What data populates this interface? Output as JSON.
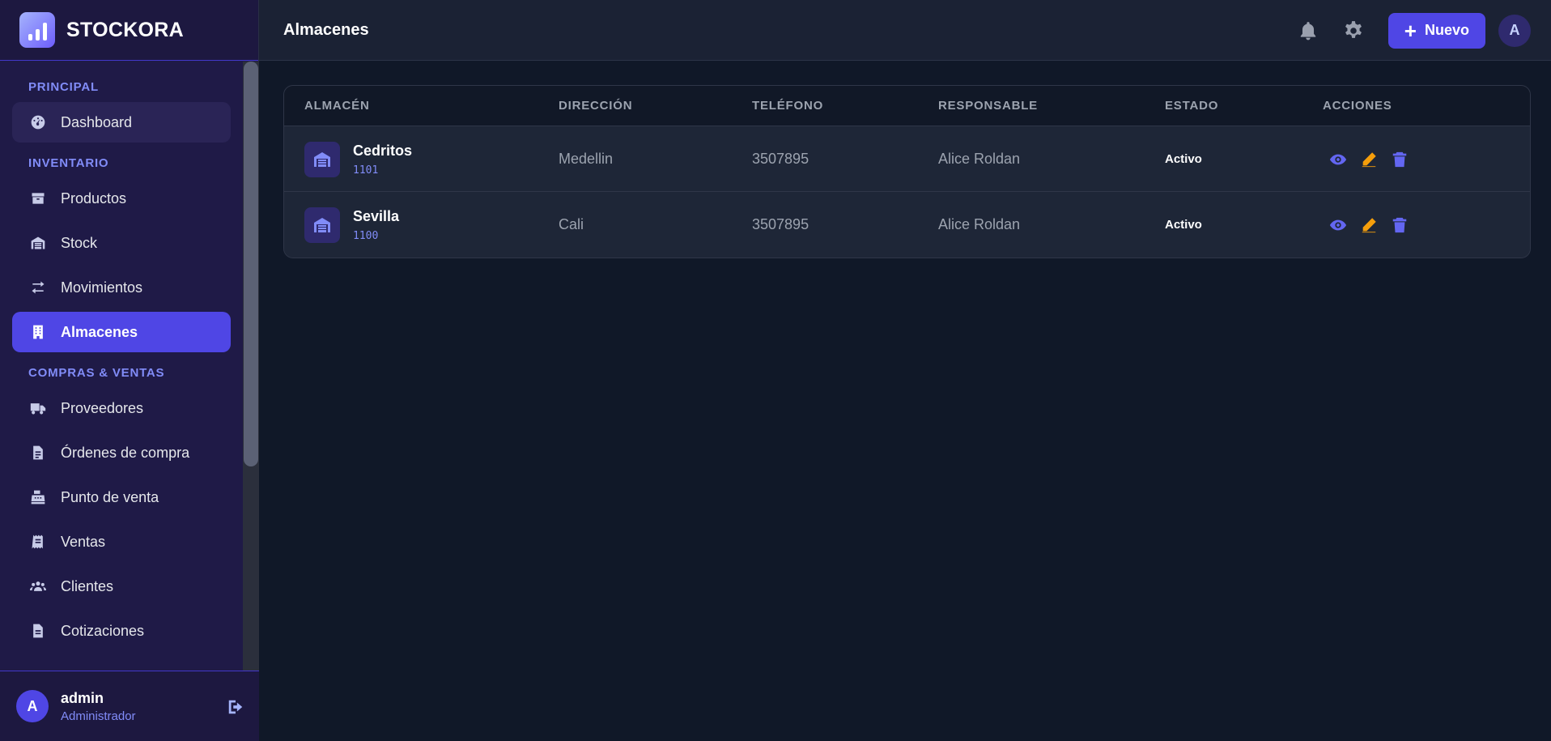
{
  "app": {
    "name": "STOCKORA"
  },
  "sidebar": {
    "sections": [
      {
        "label": "PRINCIPAL",
        "items": [
          {
            "label": "Dashboard",
            "icon": "gauge-icon"
          }
        ]
      },
      {
        "label": "INVENTARIO",
        "items": [
          {
            "label": "Productos",
            "icon": "box-icon"
          },
          {
            "label": "Stock",
            "icon": "warehouse-icon"
          },
          {
            "label": "Movimientos",
            "icon": "arrows-exchange-icon"
          },
          {
            "label": "Almacenes",
            "icon": "building-icon",
            "active": true
          }
        ]
      },
      {
        "label": "COMPRAS & VENTAS",
        "items": [
          {
            "label": "Proveedores",
            "icon": "truck-icon"
          },
          {
            "label": "Órdenes de compra",
            "icon": "file-invoice-icon"
          },
          {
            "label": "Punto de venta",
            "icon": "cash-register-icon"
          },
          {
            "label": "Ventas",
            "icon": "receipt-icon"
          },
          {
            "label": "Clientes",
            "icon": "users-icon"
          },
          {
            "label": "Cotizaciones",
            "icon": "file-lines-icon"
          }
        ]
      }
    ],
    "user": {
      "initial": "A",
      "name": "admin",
      "role": "Administrador"
    }
  },
  "header": {
    "title": "Almacenes",
    "new_label": "Nuevo",
    "avatar_initial": "A"
  },
  "table": {
    "columns": [
      "ALMACÉN",
      "DIRECCIÓN",
      "TELÉFONO",
      "RESPONSABLE",
      "ESTADO",
      "ACCIONES"
    ],
    "rows": [
      {
        "name": "Cedritos",
        "code": "1101",
        "address": "Medellin",
        "phone": "3507895",
        "manager": "Alice Roldan",
        "status": "Activo"
      },
      {
        "name": "Sevilla",
        "code": "1100",
        "address": "Cali",
        "phone": "3507895",
        "manager": "Alice Roldan",
        "status": "Activo"
      }
    ]
  },
  "colors": {
    "accent": "#4f46e5",
    "view": "#6366f1",
    "edit": "#f59e0b",
    "delete": "#6366f1"
  }
}
